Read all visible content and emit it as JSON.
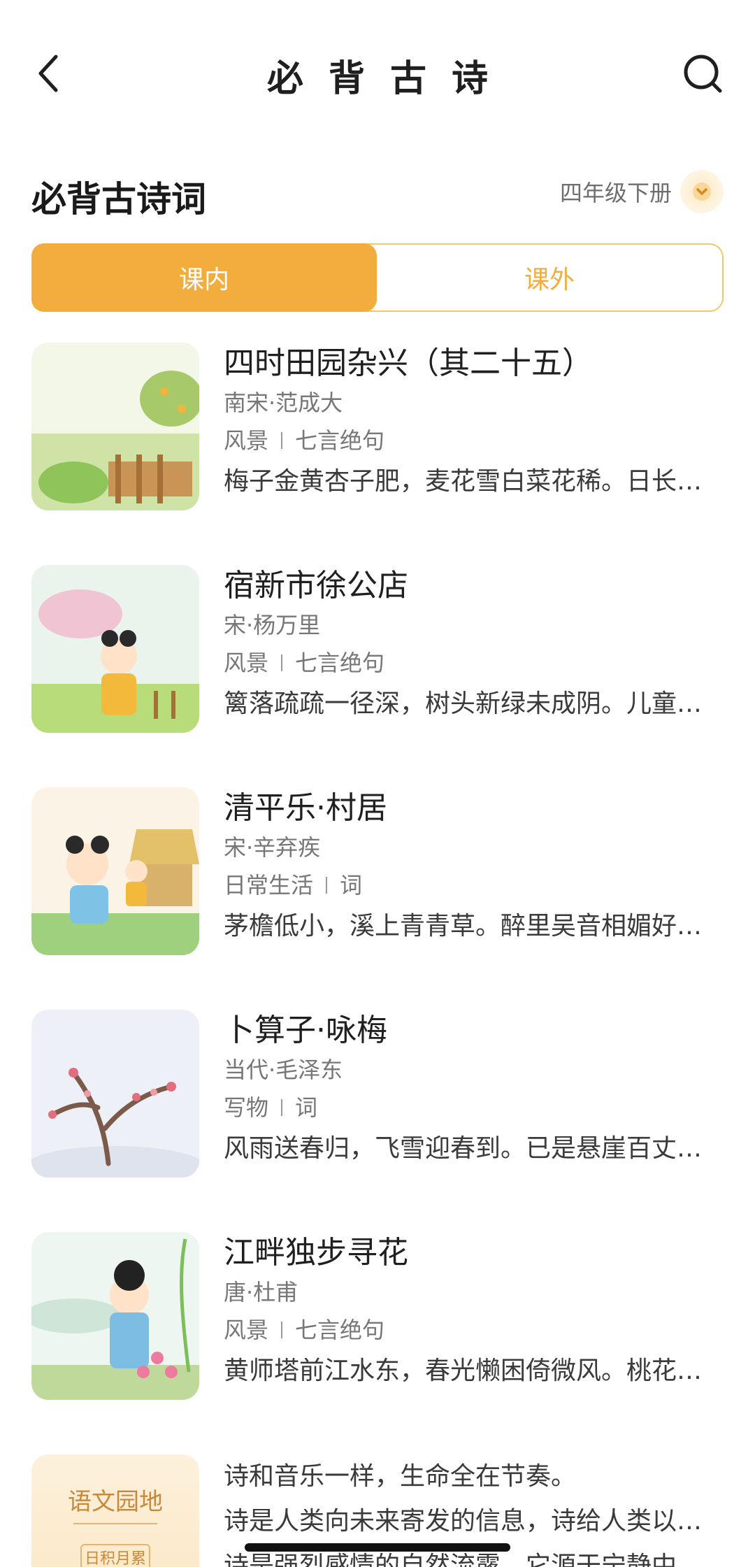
{
  "header": {
    "title": "必背古诗"
  },
  "section": {
    "title": "必背古诗词",
    "grade": "四年级下册"
  },
  "tabs": [
    {
      "label": "课内",
      "active": true
    },
    {
      "label": "课外",
      "active": false
    }
  ],
  "poems": [
    {
      "title": "四时田园杂兴（其二十五）",
      "author": "南宋·范成大",
      "tag1": "风景",
      "tag2": "七言绝句",
      "excerpt": "梅子金黄杏子肥，麦花雪白菜花稀。日长篱落无人过，惟有蜻蜓蛱蝶飞。"
    },
    {
      "title": "宿新市徐公店",
      "author": "宋·杨万里",
      "tag1": "风景",
      "tag2": "七言绝句",
      "excerpt": "篱落疏疏一径深，树头新绿未成阴。儿童急走追黄蝶，飞入菜花无处寻。"
    },
    {
      "title": "清平乐·村居",
      "author": "宋·辛弃疾",
      "tag1": "日常生活",
      "tag2": "词",
      "excerpt": "茅檐低小，溪上青青草。醉里吴音相媚好，白发谁家翁媪？"
    },
    {
      "title": "卜算子·咏梅",
      "author": "当代·毛泽东",
      "tag1": "写物",
      "tag2": "词",
      "excerpt": "风雨送春归，飞雪迎春到。已是悬崖百丈冰，犹有花枝俏。"
    },
    {
      "title": "江畔独步寻花",
      "author": "唐·杜甫",
      "tag1": "风景",
      "tag2": "七言绝句",
      "excerpt": "黄师塔前江水东，春光懒困倚微风。桃花一簇开无主，可爱深红爱浅红？"
    }
  ],
  "garden": {
    "thumb_title": "语文园地",
    "thumb_sub": "日积月累",
    "lines": [
      "诗和音乐一样，生命全在节奏。",
      "诗是人类向未来寄发的信息，诗给人类以高尚的情操。",
      "诗是强烈感情的自然流露。它源于宁静中回忆起来的情感。"
    ]
  },
  "colors": {
    "accent": "#f2ad3d",
    "tab_border": "#f5c766"
  }
}
